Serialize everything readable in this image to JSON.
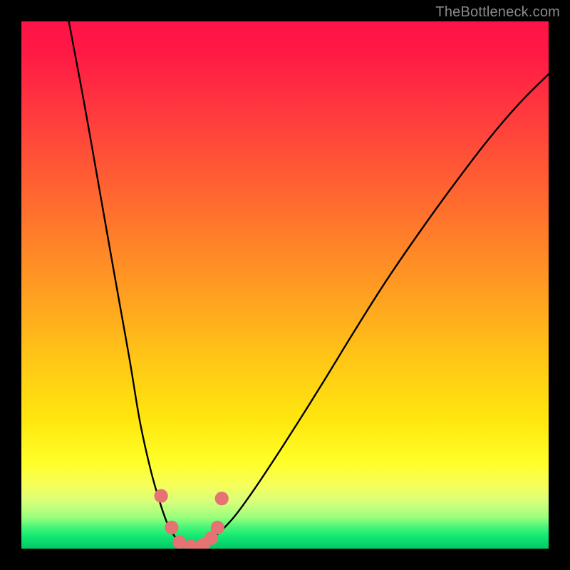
{
  "watermark": "TheBottleneck.com",
  "chart_data": {
    "type": "line",
    "title": "",
    "xlabel": "",
    "ylabel": "",
    "xlim": [
      0,
      100
    ],
    "ylim": [
      0,
      100
    ],
    "grid": false,
    "curve": {
      "name": "bottleneck-curve",
      "note": "V-shaped curve; x as fraction of plot width, y as fraction of plot height from top",
      "points": [
        [
          0.09,
          0.0
        ],
        [
          0.12,
          0.16
        ],
        [
          0.15,
          0.33
        ],
        [
          0.18,
          0.5
        ],
        [
          0.205,
          0.64
        ],
        [
          0.225,
          0.76
        ],
        [
          0.245,
          0.85
        ],
        [
          0.262,
          0.91
        ],
        [
          0.278,
          0.955
        ],
        [
          0.295,
          0.982
        ],
        [
          0.312,
          0.995
        ],
        [
          0.33,
          0.998
        ],
        [
          0.35,
          0.99
        ],
        [
          0.375,
          0.97
        ],
        [
          0.405,
          0.938
        ],
        [
          0.44,
          0.89
        ],
        [
          0.48,
          0.83
        ],
        [
          0.525,
          0.76
        ],
        [
          0.575,
          0.68
        ],
        [
          0.63,
          0.59
        ],
        [
          0.69,
          0.495
        ],
        [
          0.755,
          0.4
        ],
        [
          0.82,
          0.31
        ],
        [
          0.885,
          0.225
        ],
        [
          0.945,
          0.155
        ],
        [
          1.0,
          0.1
        ]
      ]
    },
    "markers": {
      "name": "highlight-dots",
      "color": "#e57373",
      "radius_fraction": 0.013,
      "points": [
        [
          0.265,
          0.9
        ],
        [
          0.285,
          0.96
        ],
        [
          0.3,
          0.988
        ],
        [
          0.322,
          0.996
        ],
        [
          0.345,
          0.993
        ],
        [
          0.36,
          0.98
        ],
        [
          0.372,
          0.96
        ],
        [
          0.38,
          0.905
        ]
      ]
    }
  }
}
